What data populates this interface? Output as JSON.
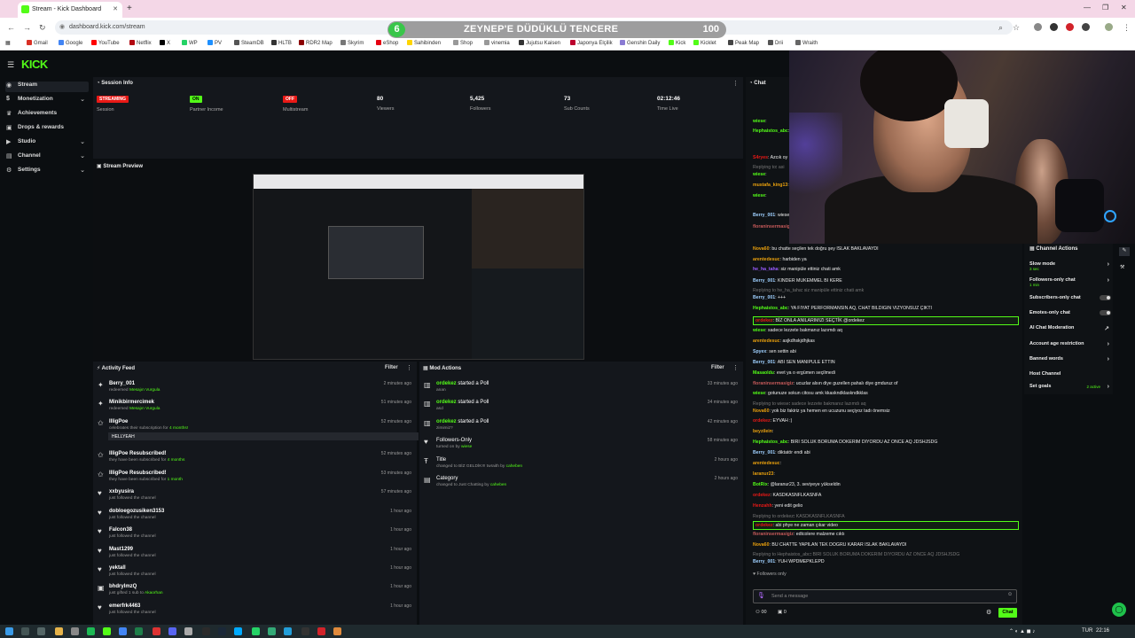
{
  "browser": {
    "tab_title": "Stream - Kick Dashboard",
    "url": "dashboard.kick.com/stream",
    "bookmarks": [
      "Gmail",
      "Google",
      "YouTube",
      "Netflix",
      "X",
      "WP",
      "PV",
      "SteamDB",
      "HLTB",
      "RDR2 Map",
      "Skyrim",
      "eShop",
      "Sahibinden",
      "Shop",
      "vinemia",
      "Jujutsu Kaisen",
      "Japonya Elçilik",
      "Genshin Daily",
      "Kick",
      "Kicklet",
      "Peak Map",
      "Drii",
      "Wraith"
    ]
  },
  "overlay": {
    "count": "6",
    "title": "ZEYNEP'E DÜDÜKLÜ TENCERE",
    "score": "100"
  },
  "sidebar": {
    "items": [
      {
        "label": "Stream",
        "icon": "broadcast-icon"
      },
      {
        "label": "Monetization",
        "icon": "dollar-icon"
      },
      {
        "label": "Achievements",
        "icon": "trophy-icon"
      },
      {
        "label": "Drops & rewards",
        "icon": "gift-icon"
      },
      {
        "label": "Studio",
        "icon": "video-icon"
      },
      {
        "label": "Channel",
        "icon": "channel-icon"
      },
      {
        "label": "Settings",
        "icon": "gear-icon"
      }
    ]
  },
  "session": {
    "title": "Session Info",
    "stats": [
      {
        "value": "STREAMING",
        "label": "Session",
        "kind": "red"
      },
      {
        "value": "ON",
        "label": "Partner Income",
        "kind": "green"
      },
      {
        "value": "OFF",
        "label": "Multistream",
        "kind": "red"
      },
      {
        "value": "80",
        "label": "Viewers",
        "kind": "text"
      },
      {
        "value": "5,425",
        "label": "Followers",
        "kind": "text"
      },
      {
        "value": "73",
        "label": "Sub Counts",
        "kind": "text"
      },
      {
        "value": "02:12:46",
        "label": "Time Live",
        "kind": "text"
      }
    ]
  },
  "preview": {
    "title": "Stream Preview"
  },
  "activity": {
    "title": "Activity Feed",
    "filter": "Filter",
    "rows": [
      {
        "who": "Berry_001",
        "sub": "redeemed",
        "hl": "Mesajın Vurgula",
        "time": "2 minutes ago",
        "icon": "sparkle-icon"
      },
      {
        "who": "Minikbirmercimek",
        "sub": "redeemed",
        "hl": "Mesajın Vurgula",
        "time": "51 minutes ago",
        "icon": "sparkle-icon"
      },
      {
        "who": "IlligPoe",
        "sub": "celebrates their subscription for",
        "hl": "4 months!",
        "time": "52 minutes ago",
        "icon": "star-icon",
        "msg": "HELLYEAH"
      },
      {
        "who": "IlligPoe Resubscribed!",
        "sub": "they have been subscribed for",
        "hl": "4 months",
        "time": "52 minutes ago",
        "icon": "star-icon"
      },
      {
        "who": "IlligPoe Resubscribed!",
        "sub": "they have been subscribed for",
        "hl": "1 month",
        "time": "53 minutes ago",
        "icon": "star-icon"
      },
      {
        "who": "xxbyusira",
        "sub": "just followed the channel",
        "hl": "",
        "time": "57 minutes ago",
        "icon": "heart-icon"
      },
      {
        "who": "dobloegozusiken3153",
        "sub": "just followed the channel",
        "hl": "",
        "time": "1 hour ago",
        "icon": "heart-icon"
      },
      {
        "who": "Falcon38",
        "sub": "just followed the channel",
        "hl": "",
        "time": "1 hour ago",
        "icon": "heart-icon"
      },
      {
        "who": "Mast1299",
        "sub": "just followed the channel",
        "hl": "",
        "time": "1 hour ago",
        "icon": "heart-icon"
      },
      {
        "who": "yektall",
        "sub": "just followed the channel",
        "hl": "",
        "time": "1 hour ago",
        "icon": "heart-icon"
      },
      {
        "who": "bhdrylmzQ",
        "sub": "just gifted 1 sub to",
        "hl": "Akaorhan",
        "time": "1 hour ago",
        "icon": "gift-icon"
      },
      {
        "who": "emerfrk4463",
        "sub": "just followed the channel",
        "hl": "",
        "time": "1 hour ago",
        "icon": "heart-icon"
      }
    ]
  },
  "mod": {
    "title": "Mod Actions",
    "filter": "Filter",
    "rows": [
      {
        "who": "ordekez",
        "action": "started a Poll",
        "sub": "anan",
        "time": "33 minutes ago",
        "icon": "poll-icon"
      },
      {
        "who": "ordekez",
        "action": "started a Poll",
        "sub": "asd",
        "time": "34 minutes ago",
        "icon": "poll-icon"
      },
      {
        "who": "ordekez",
        "action": "started a Poll",
        "sub": "zimimiz?",
        "time": "42 minutes ago",
        "icon": "poll-icon"
      },
      {
        "who": "Followers-Only",
        "action": "",
        "sub": "turned on by",
        "subhl": "wiese",
        "time": "58 minutes ago",
        "icon": "heart-icon"
      },
      {
        "who": "Title",
        "action": "",
        "sub": "changed to BİZ GELDİK!!! twraith by",
        "subhl": "caheben",
        "time": "2 hours ago",
        "icon": "title-icon"
      },
      {
        "who": "Category",
        "action": "",
        "sub": "changed to Just Chatting by",
        "subhl": "caheben",
        "time": "2 hours ago",
        "icon": "category-icon"
      }
    ]
  },
  "chat": {
    "title": "Chat",
    "messages": [
      {
        "u": "wiese",
        "c": "#53fc18",
        "t": ""
      },
      {
        "u": "Hephaistos_abc",
        "c": "#53fc18",
        "t": ""
      },
      {
        "u": "S4ryes",
        "c": "#e91916",
        "t": "Azcık oy"
      },
      {
        "u": "Replying to",
        "c": "#777",
        "t": "asi"
      },
      {
        "u": "wiese",
        "c": "#53fc18",
        "t": ""
      },
      {
        "u": "mustafa_king13",
        "c": "#e9a00d",
        "t": ""
      },
      {
        "u": "wiese",
        "c": "#53fc18",
        "t": ""
      },
      {
        "u": "Berry_001",
        "c": "#9fd0ff",
        "t": "wiese"
      },
      {
        "u": "floraninsermasigiz",
        "c": "#c65a5a",
        "t": ""
      },
      {
        "u": "Nova60",
        "c": "#e9a00d",
        "t": "bu chatte seçilen tek doğru şey ISLAK BAKLAVAYDI"
      },
      {
        "u": "arentedesuc",
        "c": "#e9a00d",
        "t": "harbiden ya"
      },
      {
        "u": "he_ha_taha",
        "c": "#9b5cff",
        "t": "siz manipüle ettiniz chati amk"
      },
      {
        "u": "Berry_001",
        "c": "#9fd0ff",
        "t": "KİNDER MÜKEMMEL Bİ KERE"
      },
      {
        "u": "Replying to he_ha_taha",
        "c": "#777",
        "t": "siz manipüle ettiniz chati amk"
      },
      {
        "u": "Berry_001",
        "c": "#9fd0ff",
        "t": "+++"
      },
      {
        "u": "Hephaistos_abc",
        "c": "#53fc18",
        "t": "YA FİYAT PERFORMANSIN AQ, CHAT BİLDİĞİN VİZYONSUZ ÇIKTI"
      },
      {
        "u": "ordekez",
        "c": "#e91916",
        "t": "BİZ ONLA ANILARIMIZI SEÇTİK @ordekez"
      },
      {
        "u": "wiese",
        "c": "#53fc18",
        "t": "sadece lezzete bakmanız lazımdı aq"
      },
      {
        "u": "arentedesuc",
        "c": "#e9a00d",
        "t": "asjkdhskjdhjkas"
      },
      {
        "u": "Spyex",
        "c": "#9fd0ff",
        "t": "sen settin abi"
      },
      {
        "u": "Berry_001",
        "c": "#9fd0ff",
        "t": "ABİ SEN MANİPÜLE ETTİN"
      },
      {
        "u": "Masaoldu",
        "c": "#53fc18",
        "t": "evet ya o ergümen seçilmedi"
      },
      {
        "u": "floraninsermasigiz",
        "c": "#c65a5a",
        "t": "ucuzlar alsın diye guzellen pahalı diye gmduruz of"
      },
      {
        "u": "wiese",
        "c": "#53fc18",
        "t": "gotunuze sokun citosu amk kkaskndklaskndkklas"
      },
      {
        "u": "Replying to wiese",
        "c": "#777",
        "t": "sadece lezzete bakmanız lazımdı aq"
      },
      {
        "u": "Nova60",
        "c": "#e9a00d",
        "t": "yok biz fakiriz ya hemen en ucuzunu seçiyoz tadı önemsiz"
      },
      {
        "u": "ordekez",
        "c": "#e91916",
        "t": "EYVAH :)"
      },
      {
        "u": "beyzilein",
        "c": "#e9a00d",
        "t": ""
      },
      {
        "u": "Hephaistos_abc",
        "c": "#53fc18",
        "t": "BİRİ SOLUK BORUMA DÖKERİM DİYORDU AZ ÖNCE AQ JDSHJSDG"
      },
      {
        "u": "Berry_001",
        "c": "#9fd0ff",
        "t": "diktatör endi abi"
      },
      {
        "u": "arentedesuc",
        "c": "#e9a00d",
        "t": ""
      },
      {
        "u": "laranur23",
        "c": "#e9a00d",
        "t": ""
      },
      {
        "u": "BotRix",
        "c": "#53fc18",
        "t": "@laranur23, 3. seviyeye yükseldin"
      },
      {
        "u": "ordekez",
        "c": "#e91916",
        "t": "KASDKASNFLKASNFA"
      },
      {
        "u": "Henzahh",
        "c": "#e91916",
        "t": "yeni edit gelio"
      },
      {
        "u": "Replying to ordekez",
        "c": "#777",
        "t": "KASDKASNFLKASNFA"
      },
      {
        "u": "ordekez",
        "c": "#e91916",
        "t": "abi phye ne zaman çıkar video"
      },
      {
        "u": "floraninsermasigiz",
        "c": "#c65a5a",
        "t": "edtcolere malzeme cıktı"
      },
      {
        "u": "Nova60",
        "c": "#e9a00d",
        "t": "BU CHATTE YAPILAN TEK DOĞRU KARAR ISLAK BAKLAVAYDI"
      },
      {
        "u": "Replying to Hephaistos_abc",
        "c": "#777",
        "t": "BİRİ SOLUK BORUMA DÖKERİM DİYORDU AZ ÖNCE AQ JDSHJSDG"
      },
      {
        "u": "Berry_001",
        "c": "#9fd0ff",
        "t": "YUH WPDMEPKLEPD"
      }
    ],
    "followers_only": "Followers only",
    "input_placeholder": "Send a message",
    "send_label": "Chat",
    "count_a": "00",
    "count_b": "0"
  },
  "actions": {
    "title": "Channel Actions",
    "items": [
      {
        "label": "Slow mode",
        "sub": "3 sec",
        "control": "chevron"
      },
      {
        "label": "Followers-only chat",
        "sub": "1 min",
        "control": "chevron"
      },
      {
        "label": "Subscribers-only chat",
        "sub": "",
        "control": "toggle"
      },
      {
        "label": "Emotes-only chat",
        "sub": "",
        "control": "toggle"
      },
      {
        "label": "AI Chat Moderation",
        "sub": "",
        "control": "link"
      },
      {
        "label": "Account age restriction",
        "sub": "",
        "control": "chevron"
      },
      {
        "label": "Banned words",
        "sub": "",
        "control": "chevron"
      },
      {
        "label": "Host Channel",
        "sub": "",
        "control": ""
      },
      {
        "label": "Set goals",
        "sub": "2 active",
        "control": "chevron"
      }
    ]
  },
  "taskbar": {
    "lang": "TUR",
    "time": "22:16"
  },
  "colors": {
    "accent": "#53fc18",
    "danger": "#e91916",
    "bg": "#0b0e11",
    "panel": "#14171c"
  }
}
